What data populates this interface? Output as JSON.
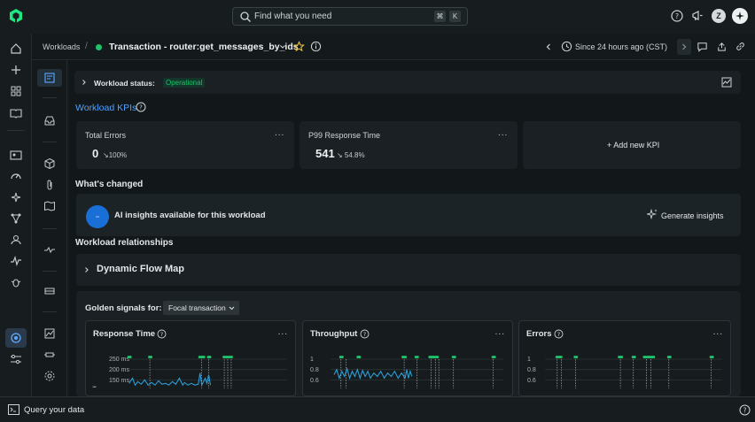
{
  "topbar": {
    "search_placeholder": "Find what you need",
    "kbd_cmd": "⌘",
    "kbd_k": "K",
    "avatar_initial": "Z"
  },
  "subheader": {
    "breadcrumb": "Workloads",
    "separator": "/",
    "entity_title": "Transaction - router:get_messages_by_ids",
    "time_range": "Since 24 hours ago (CST)"
  },
  "workload_status": {
    "label": "Workload status:",
    "value": "Operational"
  },
  "kpis": {
    "heading": "Workload KPIs",
    "cards": [
      {
        "title": "Total Errors",
        "value": "0",
        "change": "↘100%"
      },
      {
        "title": "P99 Response Time",
        "value": "541",
        "change": "↘ 54.8%"
      }
    ],
    "add_label": "+ Add new KPI",
    "menu_label": "..."
  },
  "whats_changed": {
    "heading": "What's changed",
    "ai_text": "AI insights available for this workload",
    "button_label": "Generate insights"
  },
  "relationships": {
    "heading": "Workload relationships",
    "flow_map_label": "Dynamic Flow Map"
  },
  "golden_signals": {
    "label": "Golden signals for:",
    "dropdown_value": "Focal transaction",
    "cards": [
      {
        "title": "Response Time",
        "ticks": [
          "250 ms",
          "200 ms",
          "150 ms"
        ]
      },
      {
        "title": "Throughput",
        "ticks": [
          "1",
          "0.8",
          "0.6"
        ]
      },
      {
        "title": "Errors",
        "ticks": [
          "1",
          "0.8",
          "0.6"
        ]
      }
    ]
  },
  "footer": {
    "query_label": "Query your data"
  },
  "colors": {
    "accent": "#1a6fd6",
    "status_green": "#1fc26b",
    "series": "#2b9fd9",
    "marker": "#1fc26b"
  }
}
